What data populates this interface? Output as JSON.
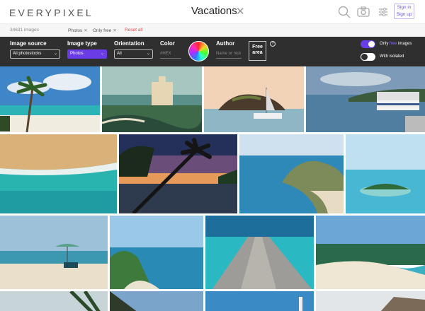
{
  "header": {
    "logo": "EVERYPIXEL",
    "query": "Vacations",
    "clear": "✕",
    "sign_in": "Sign in",
    "sign_up": "Sign up"
  },
  "subbar": {
    "count": "34631 images",
    "chips": [
      {
        "label": "Photos",
        "x": "✕"
      },
      {
        "label": "Only free",
        "x": "✕"
      }
    ],
    "reset": "Reset all"
  },
  "filters": {
    "image_source": {
      "label": "Image source",
      "value": "All photostocks"
    },
    "image_type": {
      "label": "Image type",
      "value": "Photos"
    },
    "orientation": {
      "label": "Orientation",
      "value": "All"
    },
    "color": {
      "label": "Color",
      "placeholder": "#HEX"
    },
    "author": {
      "label": "Author",
      "placeholder": "Name or nick"
    },
    "free_area": "Free area",
    "help": "?",
    "only_free": {
      "prefix": "Only ",
      "accent": "free",
      "suffix": " images",
      "on": true
    },
    "with_isolated": {
      "label": "With isolated",
      "on": false
    }
  },
  "colors": {
    "accent": "#6a3ce6",
    "dark_bar": "#2f2f2f",
    "reset": "#e04a4a"
  },
  "tiles": [
    "palm-beach-photo",
    "resort-hotel-photo",
    "sailboat-rock-photo",
    "harbor-village-photo",
    "sandy-shore-aerial-photo",
    "palm-sunset-photo",
    "coastal-cliff-photo",
    "small-island-photo",
    "beach-umbrella-photo",
    "green-cliff-coast-photo",
    "wooden-pier-photo",
    "tropical-beach-photo",
    "palm-leaves-photo",
    "ocean-view-photo",
    "lighthouse-photo",
    "rocky-coast-photo"
  ]
}
